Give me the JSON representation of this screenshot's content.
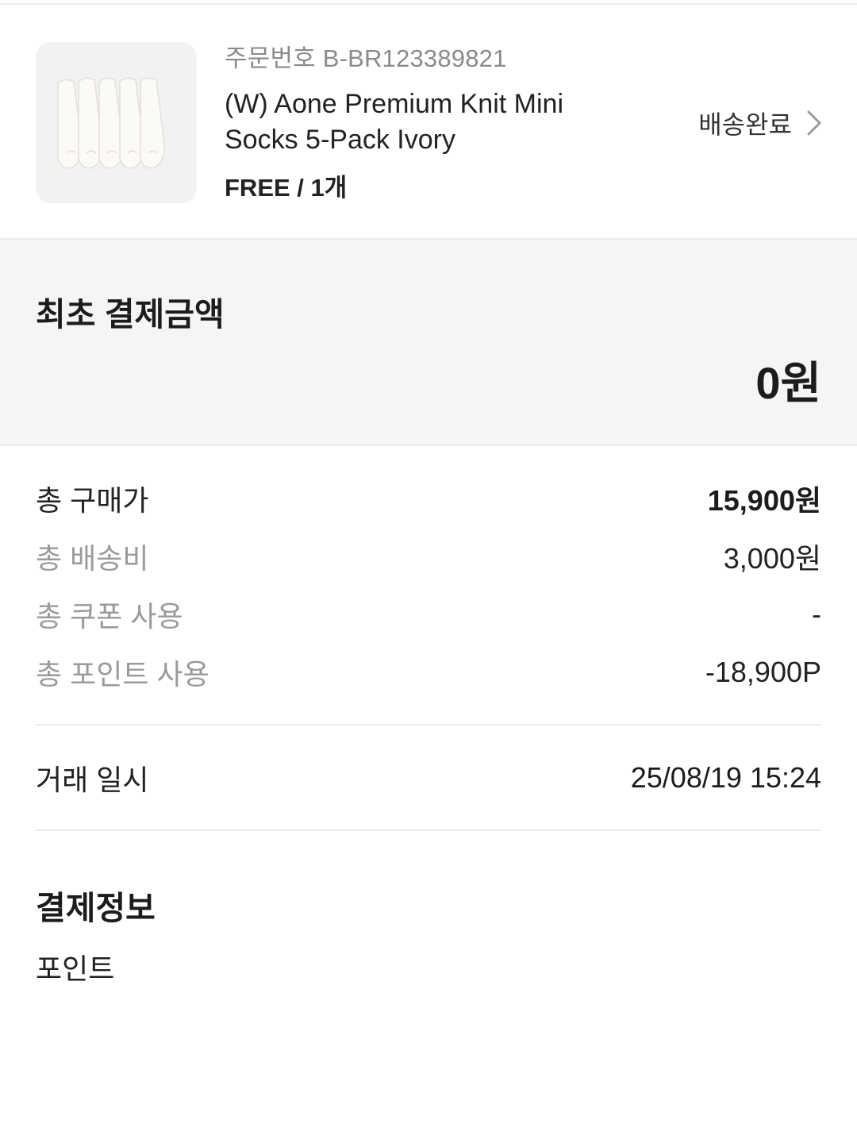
{
  "order": {
    "order_number": "주문번호 B-BR123389821",
    "product_name": "(W) Aone Premium Knit Mini Socks 5-Pack Ivory",
    "option": "FREE / 1개",
    "status": "배송완료",
    "thumbnail_icon": "socks-product-image"
  },
  "initial_payment": {
    "title": "최초 결제금액",
    "amount": "0원"
  },
  "breakdown": [
    {
      "label": "총 구매가",
      "value": "15,900원"
    },
    {
      "label": "총 배송비",
      "value": "3,000원"
    },
    {
      "label": "총 쿠폰 사용",
      "value": "-"
    },
    {
      "label": "총 포인트 사용",
      "value": "-18,900P"
    }
  ],
  "transaction": {
    "label": "거래 일시",
    "value": "25/08/19 15:24"
  },
  "payment_info": {
    "title": "결제정보",
    "method": "포인트"
  },
  "icons": {
    "status_chevron": "chevron-right-icon"
  },
  "colors": {
    "muted_text": "#9a9a9a",
    "section_bg": "#f5f5f5"
  }
}
